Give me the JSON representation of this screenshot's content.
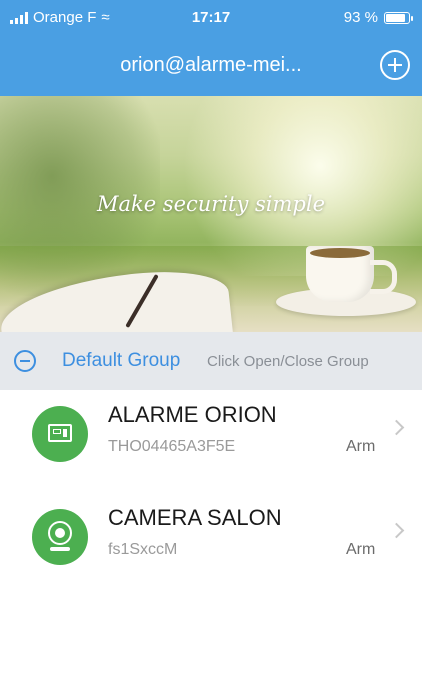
{
  "status_bar": {
    "carrier": "Orange F",
    "time": "17:17",
    "battery": "93 %",
    "battery_level": 0.93
  },
  "nav": {
    "title": "orion@alarme-mei...",
    "add_icon": "plus-circle-icon"
  },
  "banner": {
    "tagline": "Make security simple"
  },
  "group": {
    "name": "Default Group",
    "hint": "Click Open/Close Group",
    "toggle_icon": "minus-circle-icon"
  },
  "devices": [
    {
      "name": "ALARME ORION",
      "id": "THO04465A3F5E",
      "state": "Arm",
      "icon": "alarm-panel-icon"
    },
    {
      "name": "CAMERA SALON",
      "id": "fs1SxccM",
      "state": "Arm",
      "icon": "camera-icon"
    }
  ],
  "colors": {
    "header_blue": "#4a9fe3",
    "accent_blue": "#3d8fe0",
    "device_green": "#4caf50",
    "group_bg": "#e5e8ec"
  }
}
